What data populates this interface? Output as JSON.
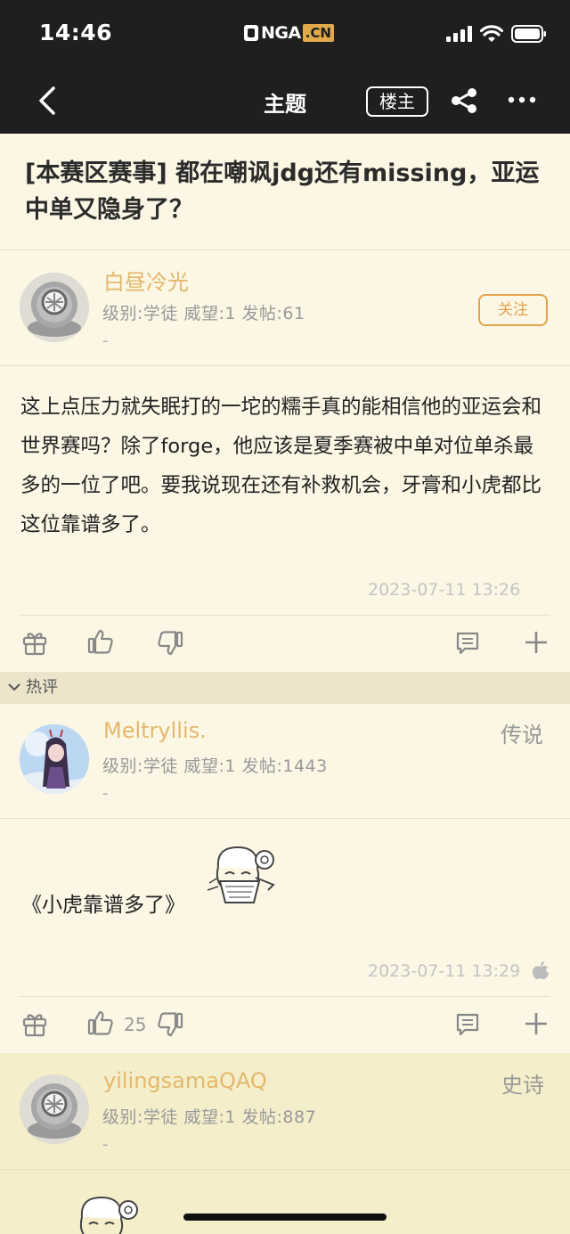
{
  "status": {
    "time": "14:46"
  },
  "logo": {
    "text_main": "NGA",
    "text_cn": ".CN"
  },
  "navbar": {
    "title": "主题",
    "op_button": "楼主"
  },
  "post": {
    "title": "[本赛区赛事] 都在嘲讽jdg还有missing，亚运中单又隐身了？",
    "author": {
      "name": "白昼冷光",
      "info": "级别:学徒  威望:1  发帖:61",
      "extra": "-"
    },
    "follow_label": "关注",
    "content": "这上点压力就失眠打的一坨的糯手真的能相信他的亚运会和世界赛吗？除了forge，他应该是夏季赛被中单对位单杀最多的一位了吧。要我说现在还有补救机会，牙膏和小虎都比这位靠谱多了。",
    "date": "2023-07-11 13:26"
  },
  "hot_section": {
    "label": "热评"
  },
  "reply1": {
    "author": {
      "name": "Meltryllis.",
      "info": "级别:学徒  威望:1  发帖:1443",
      "extra": "-"
    },
    "rank": "传说",
    "content": "《小虎靠谱多了》",
    "date": "2023-07-11 13:29",
    "likes": "25"
  },
  "reply2": {
    "author": {
      "name": "yilingsamaQAQ",
      "info": "级别:学徒  威望:1  发帖:887",
      "extra": "-"
    },
    "rank": "史诗"
  },
  "colors": {
    "accent": "#e3a34c",
    "username": "#e3b86c",
    "background": "#fbf7e4",
    "topbar": "#1f1f1f"
  },
  "icons": [
    "back-icon",
    "share-icon",
    "more-icon",
    "gift-icon",
    "thumbs-up-icon",
    "thumbs-down-icon",
    "comment-icon",
    "plus-icon",
    "apple-icon",
    "chevron-down-icon"
  ]
}
